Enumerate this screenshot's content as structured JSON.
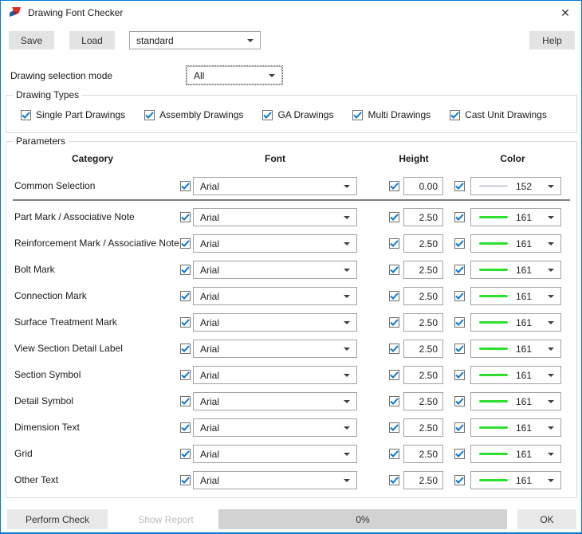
{
  "window": {
    "title": "Drawing Font Checker",
    "close_glyph": "✕"
  },
  "toolbar": {
    "save_label": "Save",
    "load_label": "Load",
    "preset_value": "standard",
    "help_label": "Help"
  },
  "selection_mode": {
    "label": "Drawing selection mode",
    "value": "All"
  },
  "drawing_types": {
    "legend": "Drawing Types",
    "items": [
      {
        "label": "Single Part Drawings",
        "checked": true
      },
      {
        "label": "Assembly Drawings",
        "checked": true
      },
      {
        "label": "GA Drawings",
        "checked": true
      },
      {
        "label": "Multi Drawings",
        "checked": true
      },
      {
        "label": "Cast Unit Drawings",
        "checked": true
      }
    ]
  },
  "parameters": {
    "legend": "Parameters",
    "headers": {
      "category": "Category",
      "font": "Font",
      "height": "Height",
      "color": "Color"
    },
    "common_row": {
      "category": "Common Selection",
      "font": "Arial",
      "font_checked": true,
      "height": "0.00",
      "height_checked": true,
      "color_value": "152",
      "color_hex": "#d9d9ea",
      "color_checked": true
    },
    "rows": [
      {
        "category": "Part Mark / Associative Note",
        "font": "Arial",
        "font_checked": true,
        "height": "2.50",
        "height_checked": true,
        "color_value": "161",
        "color_hex": "#2ee02e",
        "color_checked": true
      },
      {
        "category": "Reinforcement Mark / Associative Note",
        "font": "Arial",
        "font_checked": true,
        "height": "2.50",
        "height_checked": true,
        "color_value": "161",
        "color_hex": "#2ee02e",
        "color_checked": true
      },
      {
        "category": "Bolt Mark",
        "font": "Arial",
        "font_checked": true,
        "height": "2.50",
        "height_checked": true,
        "color_value": "161",
        "color_hex": "#2ee02e",
        "color_checked": true
      },
      {
        "category": "Connection Mark",
        "font": "Arial",
        "font_checked": true,
        "height": "2.50",
        "height_checked": true,
        "color_value": "161",
        "color_hex": "#2ee02e",
        "color_checked": true
      },
      {
        "category": "Surface Treatment Mark",
        "font": "Arial",
        "font_checked": true,
        "height": "2.50",
        "height_checked": true,
        "color_value": "161",
        "color_hex": "#2ee02e",
        "color_checked": true
      },
      {
        "category": "View Section Detail Label",
        "font": "Arial",
        "font_checked": true,
        "height": "2.50",
        "height_checked": true,
        "color_value": "161",
        "color_hex": "#2ee02e",
        "color_checked": true
      },
      {
        "category": "Section Symbol",
        "font": "Arial",
        "font_checked": true,
        "height": "2.50",
        "height_checked": true,
        "color_value": "161",
        "color_hex": "#2ee02e",
        "color_checked": true
      },
      {
        "category": "Detail Symbol",
        "font": "Arial",
        "font_checked": true,
        "height": "2.50",
        "height_checked": true,
        "color_value": "161",
        "color_hex": "#2ee02e",
        "color_checked": true
      },
      {
        "category": "Dimension Text",
        "font": "Arial",
        "font_checked": true,
        "height": "2.50",
        "height_checked": true,
        "color_value": "161",
        "color_hex": "#2ee02e",
        "color_checked": true
      },
      {
        "category": "Grid",
        "font": "Arial",
        "font_checked": true,
        "height": "2.50",
        "height_checked": true,
        "color_value": "161",
        "color_hex": "#2ee02e",
        "color_checked": true
      },
      {
        "category": "Other Text",
        "font": "Arial",
        "font_checked": true,
        "height": "2.50",
        "height_checked": true,
        "color_value": "161",
        "color_hex": "#2ee02e",
        "color_checked": true
      }
    ]
  },
  "footer": {
    "perform_check_label": "Perform Check",
    "show_report_label": "Show Report",
    "progress_text": "0%",
    "ok_label": "OK"
  },
  "colors": {
    "window_border": "#0079d7",
    "checkbox_check": "#0b76d1"
  }
}
